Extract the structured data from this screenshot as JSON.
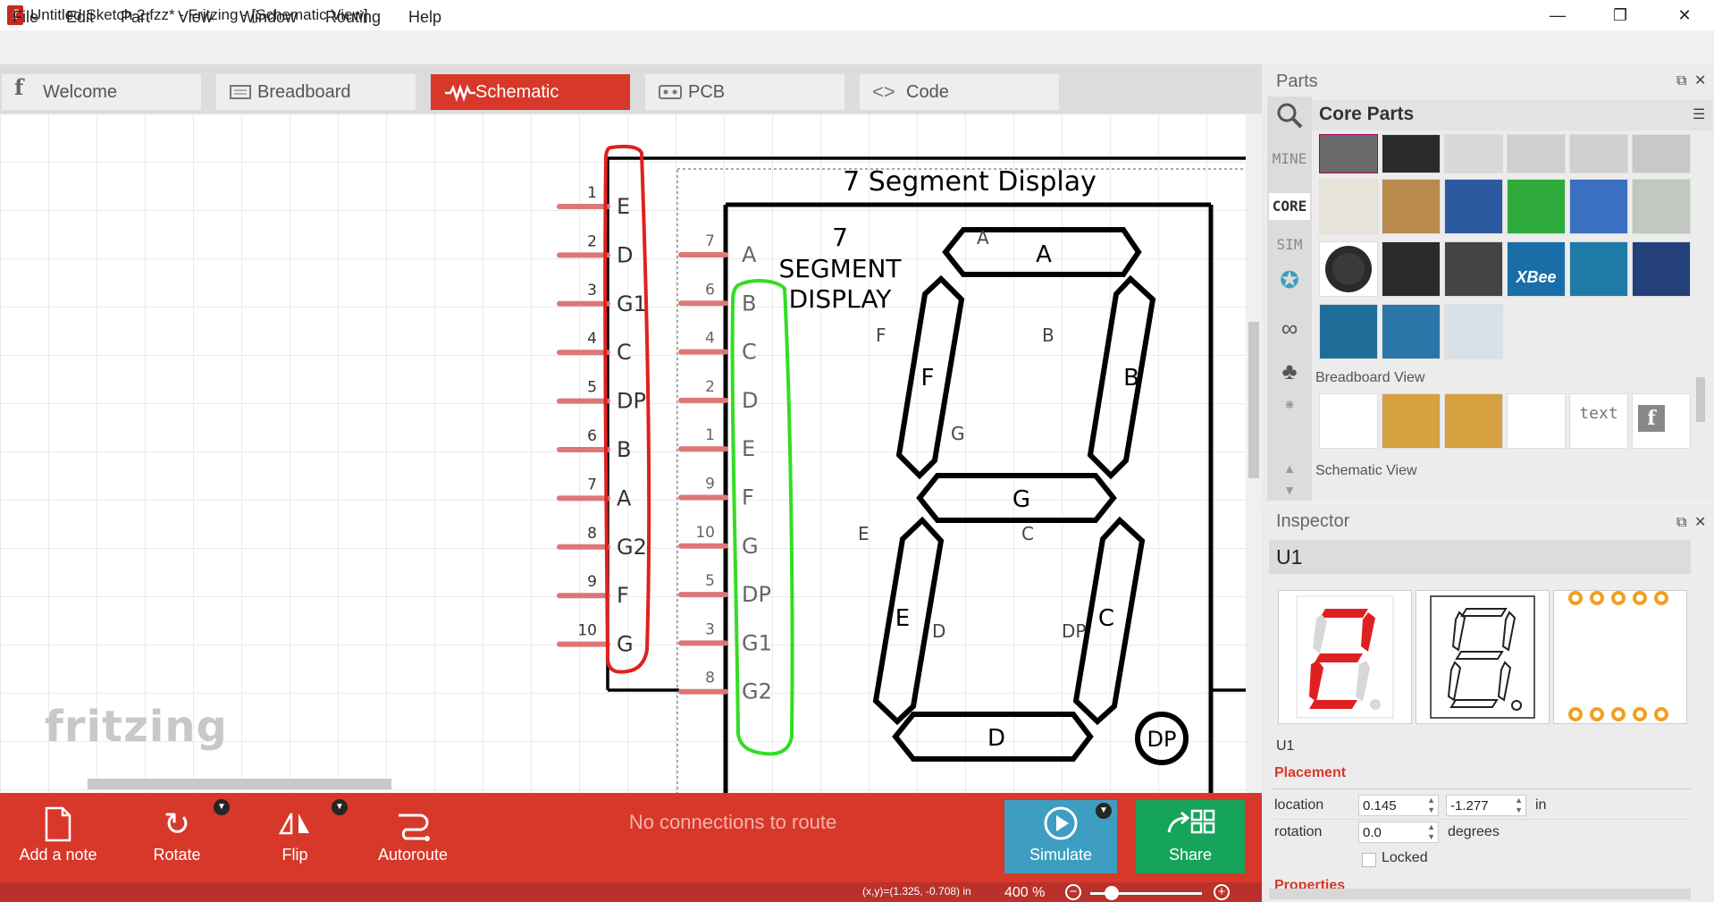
{
  "window": {
    "title": "Untitled Sketch 2.fzz* - Fritzing - [Schematic View]",
    "app_icon": "f",
    "controls": {
      "minimize": "—",
      "maximize": "❐",
      "close": "✕"
    }
  },
  "menu": [
    "File",
    "Edit",
    "Part",
    "View",
    "Window",
    "Routing",
    "Help"
  ],
  "tabs": [
    {
      "label": "Welcome",
      "icon": "fritzing-f-icon"
    },
    {
      "label": "Breadboard",
      "icon": "breadboard-icon"
    },
    {
      "label": "Schematic",
      "icon": "schematic-wave-icon",
      "active": true
    },
    {
      "label": "PCB",
      "icon": "pcb-icon"
    },
    {
      "label": "Code",
      "icon": "code-brackets-icon"
    }
  ],
  "canvas": {
    "logo": "fritzing",
    "part": {
      "title": "7 Segment Display",
      "body_label": [
        "7",
        "SEGMENT",
        "DISPLAY"
      ],
      "left_pins": [
        {
          "num": "1",
          "label": "E"
        },
        {
          "num": "2",
          "label": "D"
        },
        {
          "num": "3",
          "label": "G1"
        },
        {
          "num": "4",
          "label": "C"
        },
        {
          "num": "5",
          "label": "DP"
        },
        {
          "num": "6",
          "label": "B"
        },
        {
          "num": "7",
          "label": "A"
        },
        {
          "num": "8",
          "label": "G2"
        },
        {
          "num": "9",
          "label": "F"
        },
        {
          "num": "10",
          "label": "G"
        }
      ],
      "inner_pins": [
        {
          "num": "7",
          "label": "A"
        },
        {
          "num": "6",
          "label": "B"
        },
        {
          "num": "4",
          "label": "C"
        },
        {
          "num": "2",
          "label": "D"
        },
        {
          "num": "1",
          "label": "E"
        },
        {
          "num": "9",
          "label": "F"
        },
        {
          "num": "10",
          "label": "G"
        },
        {
          "num": "5",
          "label": "DP"
        },
        {
          "num": "3",
          "label": "G1"
        },
        {
          "num": "8",
          "label": "G2"
        }
      ],
      "segments": {
        "A": "A",
        "B": "B",
        "C": "C",
        "D": "D",
        "E": "E",
        "F": "F",
        "G": "G",
        "DP": "DP"
      },
      "segment_small_labels": {
        "A": "A",
        "B": "B",
        "C": "C",
        "D": "D",
        "E": "E",
        "F": "F",
        "G": "G",
        "DP": "DP"
      }
    },
    "annotation_colors": {
      "left_box": "#e02020",
      "inner_box": "#33dd22"
    }
  },
  "toolbar": {
    "add_note": "Add a note",
    "rotate": "Rotate",
    "flip": "Flip",
    "autoroute": "Autoroute",
    "routing_status": "No connections to route",
    "simulate": "Simulate",
    "share": "Share"
  },
  "status": {
    "coords": "(x,y)=(1.325, -0.708) in",
    "zoom": "400 %",
    "zoom_out": "−",
    "zoom_in": "+"
  },
  "parts": {
    "title": "Parts",
    "bin_title": "Core Parts",
    "bin_tabs": [
      "MINE",
      "CORE",
      "SIM"
    ],
    "section_breadboard": "Breadboard View",
    "section_schematic": "Schematic View",
    "part_texts": {
      "xbee": "XBee",
      "text": "text",
      "logo": "f"
    }
  },
  "inspector": {
    "title": "Inspector",
    "name": "U1",
    "label": "U1",
    "placement_header": "Placement",
    "location_label": "location",
    "location_x": "0.145",
    "location_y": "-1.277",
    "location_unit": "in",
    "rotation_label": "rotation",
    "rotation_value": "0.0",
    "rotation_unit": "degrees",
    "locked_label": "Locked",
    "properties_header": "Properties"
  },
  "colors": {
    "accent": "#d7382a",
    "simulate": "#3d9ec1",
    "share": "#16a35a",
    "segment_lit": "#e02020"
  }
}
